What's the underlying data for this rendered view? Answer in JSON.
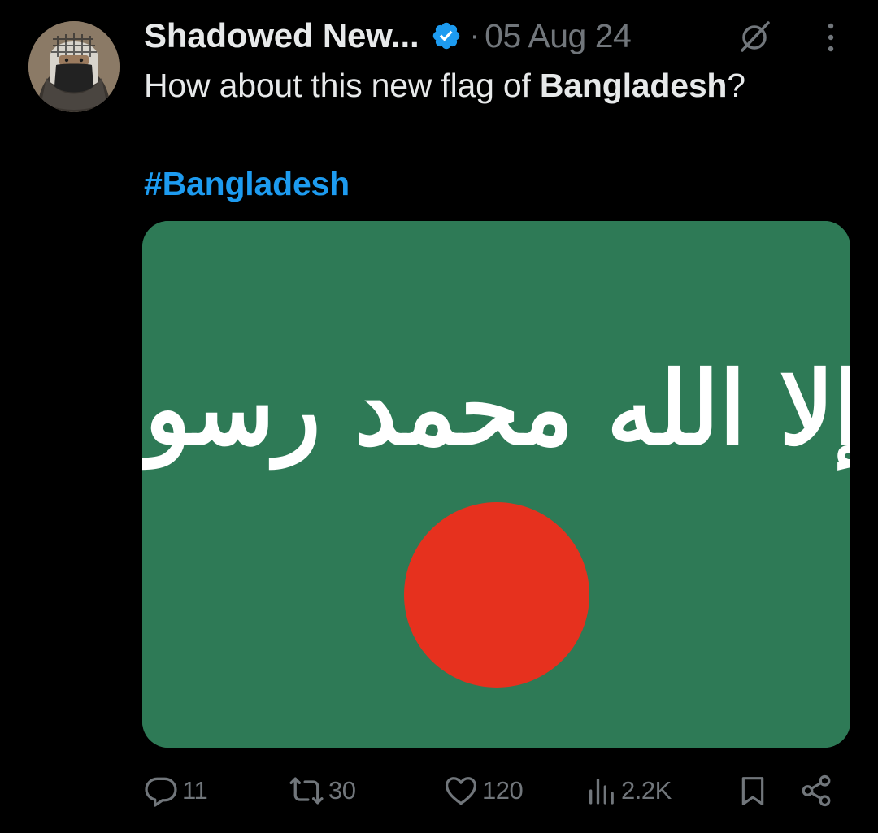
{
  "author": {
    "display_name": "Shadowed New...",
    "verified": true,
    "avatar_icon": "person-keffiyeh-avatar",
    "date": "05 Aug 24",
    "separator": "·"
  },
  "tweet": {
    "text_before": "How about this new flag of ",
    "text_bold": "Bangladesh",
    "text_after": "?",
    "hashtag": "#Bangladesh"
  },
  "media": {
    "flag_script": "لا إله إلا الله محمد رسول الله",
    "field_color": "#2e7a56",
    "disc_color": "#e6311e",
    "script_color": "#ffffff"
  },
  "actions": {
    "replies": "11",
    "reposts": "30",
    "likes": "120",
    "views": "2.2K"
  },
  "colors": {
    "background": "#000000",
    "text": "#e7e9ea",
    "muted": "#71767b",
    "link": "#1d9bf0",
    "verified_badge": "#1d9bf0"
  },
  "icons": [
    "grok-icon",
    "more-icon",
    "reply-icon",
    "repost-icon",
    "like-icon",
    "views-icon",
    "bookmark-icon",
    "share-icon",
    "verified-badge-icon"
  ]
}
